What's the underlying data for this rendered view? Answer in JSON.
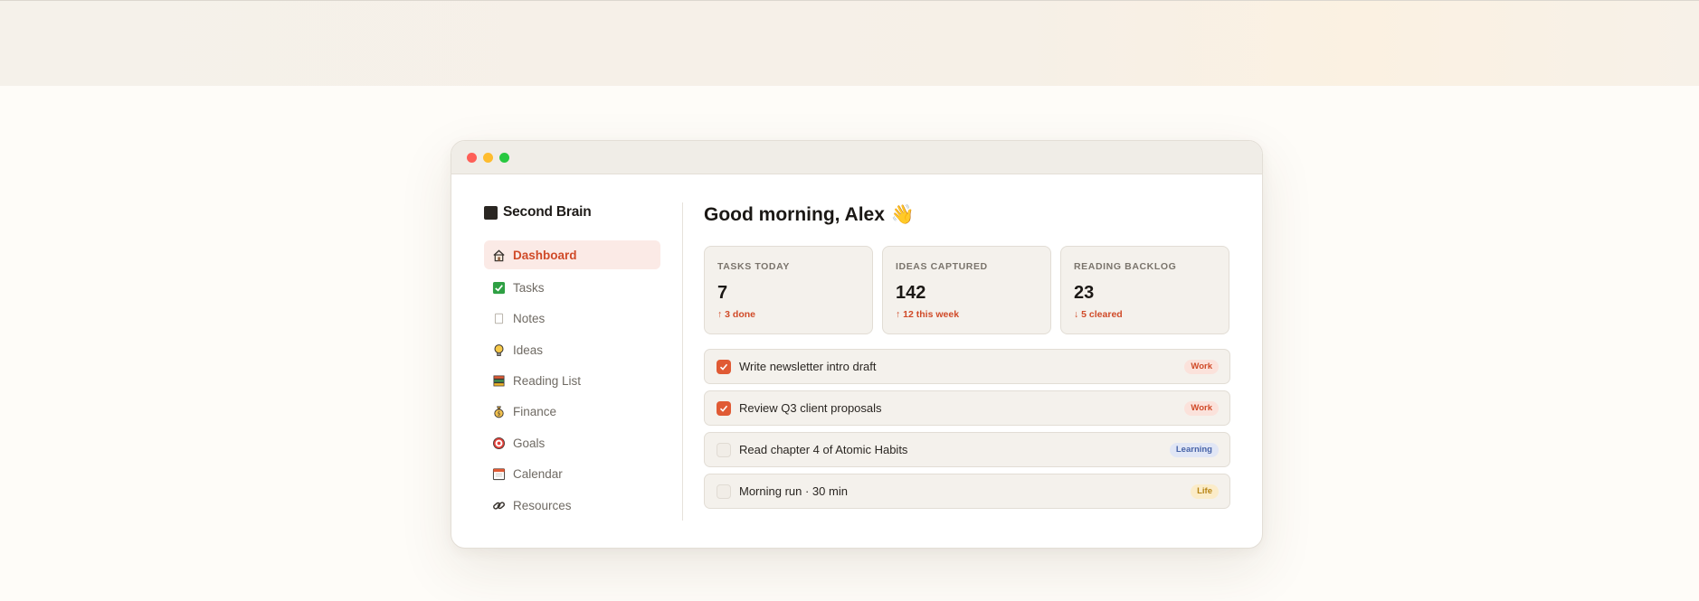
{
  "app": {
    "brand": "Second Brain"
  },
  "sidebar": {
    "items": [
      {
        "label": "Dashboard",
        "icon": "house-icon",
        "active": true
      },
      {
        "label": "Tasks",
        "icon": "checkbox-icon",
        "active": false
      },
      {
        "label": "Notes",
        "icon": "note-icon",
        "active": false
      },
      {
        "label": "Ideas",
        "icon": "lightbulb-icon",
        "active": false
      },
      {
        "label": "Reading List",
        "icon": "books-icon",
        "active": false
      },
      {
        "label": "Finance",
        "icon": "money-bag-icon",
        "active": false
      },
      {
        "label": "Goals",
        "icon": "target-icon",
        "active": false
      },
      {
        "label": "Calendar",
        "icon": "calendar-icon",
        "active": false
      },
      {
        "label": "Resources",
        "icon": "link-icon",
        "active": false
      }
    ]
  },
  "main": {
    "greeting": "Good morning, Alex",
    "greeting_emoji": "👋",
    "stats": [
      {
        "label": "TASKS TODAY",
        "value": "7",
        "delta": "↑ 3 done"
      },
      {
        "label": "IDEAS CAPTURED",
        "value": "142",
        "delta": "↑ 12 this week"
      },
      {
        "label": "READING BACKLOG",
        "value": "23",
        "delta": "↓ 5 cleared"
      }
    ],
    "tasks": [
      {
        "text": "Write newsletter intro draft",
        "done": true,
        "tag": "Work"
      },
      {
        "text": "Review Q3 client proposals",
        "done": true,
        "tag": "Work"
      },
      {
        "text": "Read chapter 4 of Atomic Habits",
        "done": false,
        "tag": "Learning"
      },
      {
        "text": "Morning run · 30 min",
        "done": false,
        "tag": "Life"
      }
    ]
  },
  "colors": {
    "accent": "#d04a28",
    "checked": "#e05a34",
    "background": "#fefcf8"
  }
}
